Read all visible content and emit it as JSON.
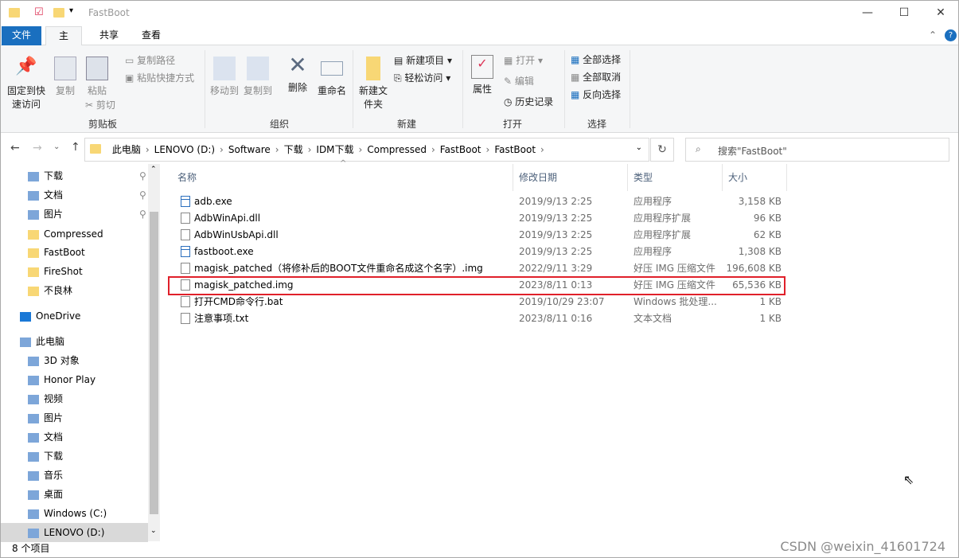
{
  "window": {
    "title": "FastBoot",
    "minimize": "—",
    "maximize": "☐",
    "close": "✕"
  },
  "tabs": {
    "file": "文件",
    "home": "主页",
    "share": "共享",
    "view": "查看"
  },
  "ribbon": {
    "pin": "固定到快速访问",
    "copy": "复制",
    "paste": "粘贴",
    "copy_path": "复制路径",
    "paste_shortcut": "粘贴快捷方式",
    "cut": "剪切",
    "clipboard": "剪贴板",
    "move_to": "移动到",
    "copy_to": "复制到",
    "delete": "删除",
    "rename": "重命名",
    "organize": "组织",
    "new_folder": "新建文件夹",
    "new_item": "新建项目",
    "easy_access": "轻松访问",
    "new": "新建",
    "properties": "属性",
    "open": "打开",
    "edit": "编辑",
    "history": "历史记录",
    "open_group": "打开",
    "select_all": "全部选择",
    "select_none": "全部取消",
    "invert": "反向选择",
    "select": "选择"
  },
  "address": {
    "crumbs": [
      "此电脑",
      "LENOVO (D:)",
      "Software",
      "下载",
      "IDM下载",
      "Compressed",
      "FastBoot",
      "FastBoot"
    ],
    "search_placeholder": "搜索\"FastBoot\""
  },
  "nav": [
    {
      "label": "下载",
      "pinned": true
    },
    {
      "label": "文档",
      "pinned": true
    },
    {
      "label": "图片",
      "pinned": true
    },
    {
      "label": "Compressed"
    },
    {
      "label": "FastBoot"
    },
    {
      "label": "FireShot"
    },
    {
      "label": "不良林"
    },
    {
      "label": "OneDrive"
    },
    {
      "label": "此电脑"
    },
    {
      "label": "3D 对象"
    },
    {
      "label": "Honor Play"
    },
    {
      "label": "视频"
    },
    {
      "label": "图片"
    },
    {
      "label": "文档"
    },
    {
      "label": "下载"
    },
    {
      "label": "音乐"
    },
    {
      "label": "桌面"
    },
    {
      "label": "Windows (C:)"
    },
    {
      "label": "LENOVO (D:)"
    }
  ],
  "columns": {
    "name": "名称",
    "date": "修改日期",
    "type": "类型",
    "size": "大小"
  },
  "files": [
    {
      "name": "adb.exe",
      "date": "2019/9/13 2:25",
      "type": "应用程序",
      "size": "3,158 KB",
      "icon": "exe"
    },
    {
      "name": "AdbWinApi.dll",
      "date": "2019/9/13 2:25",
      "type": "应用程序扩展",
      "size": "96 KB",
      "icon": "dll"
    },
    {
      "name": "AdbWinUsbApi.dll",
      "date": "2019/9/13 2:25",
      "type": "应用程序扩展",
      "size": "62 KB",
      "icon": "dll"
    },
    {
      "name": "fastboot.exe",
      "date": "2019/9/13 2:25",
      "type": "应用程序",
      "size": "1,308 KB",
      "icon": "exe"
    },
    {
      "name": "magisk_patched（将修补后的BOOT文件重命名成这个名字）.img",
      "date": "2022/9/11 3:29",
      "type": "好压 IMG 压缩文件",
      "size": "196,608 KB",
      "icon": "file"
    },
    {
      "name": "magisk_patched.img",
      "date": "2023/8/11 0:13",
      "type": "好压 IMG 压缩文件",
      "size": "65,536 KB",
      "icon": "file",
      "highlighted": true
    },
    {
      "name": "打开CMD命令行.bat",
      "date": "2019/10/29 23:07",
      "type": "Windows 批处理...",
      "size": "1 KB",
      "icon": "bat"
    },
    {
      "name": "注意事项.txt",
      "date": "2023/8/11 0:16",
      "type": "文本文档",
      "size": "1 KB",
      "icon": "txt"
    }
  ],
  "status": {
    "count": "8 个项目"
  },
  "watermark": "CSDN @weixin_41601724",
  "colors": {
    "accent": "#1a6fbf",
    "highlight_border": "#e0202a"
  }
}
